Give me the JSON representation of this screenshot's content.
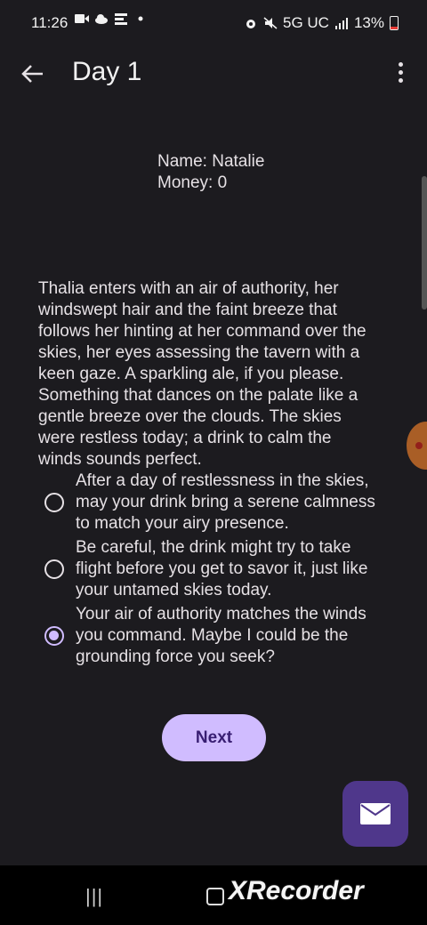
{
  "status_bar": {
    "time": "11:26",
    "network": "5G UC",
    "battery": "13%",
    "icons": [
      "video-icon",
      "cloud-icon",
      "app-icon",
      "dot-icon",
      "alarm-icon",
      "mute-icon",
      "signal-icon",
      "battery-icon"
    ]
  },
  "app_bar": {
    "title": "Day 1"
  },
  "player": {
    "name": "Name: Natalie",
    "money": "Money: 0"
  },
  "story": {
    "text": "Thalia enters with an air of authority, her windswept hair and the faint breeze that follows her hinting at her command over the skies, her eyes assessing the tavern with a keen gaze. A sparkling ale, if you please. Something that dances on the palate like a gentle breeze over the clouds. The skies were restless today; a drink to calm the winds sounds perfect."
  },
  "choices": [
    {
      "text": "After a day of restlessness in the skies, may your drink bring a serene calmness to match your airy presence.",
      "selected": false
    },
    {
      "text": "Be careful, the drink might try to take flight before you get to savor it, just like your untamed skies today.",
      "selected": false
    },
    {
      "text": "Your air of authority matches the winds you command. Maybe I could be the grounding force you seek?",
      "selected": true
    }
  ],
  "next_button": {
    "label": "Next"
  },
  "fab": {
    "icon": "envelope-icon"
  },
  "nav_bar": {
    "recent": "|||",
    "watermark": "XRecorder"
  },
  "colors": {
    "background": "#1c1b1f",
    "accent": "#d0bcff",
    "fab": "#4f378b"
  }
}
